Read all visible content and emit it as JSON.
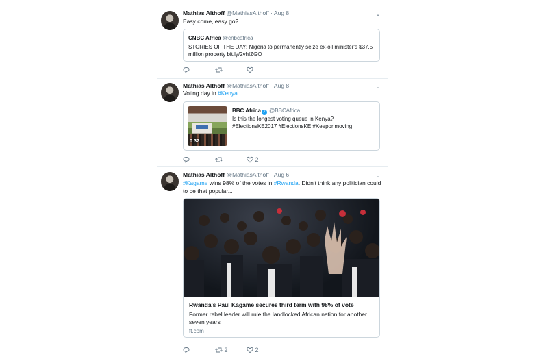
{
  "tweets": [
    {
      "name": "Mathias Althoff",
      "handle": "@MathiasAlthoff",
      "dot": "·",
      "date": "Aug 8",
      "text": "Easy come, easy go?",
      "quote": {
        "name": "CNBC Africa",
        "handle": "@cnbcafrica",
        "text_line1": "STORIES OF THE DAY: Nigeria to permanently seize ex-oil minister's $37.5",
        "text_line2": "million property bit.ly/2vhIZGO"
      },
      "retweets": "",
      "likes": ""
    },
    {
      "name": "Mathias Althoff",
      "handle": "@MathiasAlthoff",
      "dot": "·",
      "date": "Aug 8",
      "text_prefix": "Voting day in ",
      "text_link": "#Kenya",
      "text_suffix": ".",
      "quote": {
        "name": "BBC Africa",
        "handle": "@BBCAfrica",
        "text_line1": "Is this the longest voting queue in Kenya?",
        "text_line2": "#ElectionsKE2017 #ElectionsKE #Keeponmoving",
        "duration": "0:32"
      },
      "retweets": "",
      "likes": "2"
    },
    {
      "name": "Mathias Althoff",
      "handle": "@MathiasAlthoff",
      "dot": "·",
      "date": "Aug 6",
      "text_link1": "#Kagame",
      "text_mid": " wins 98% of the votes in ",
      "text_link2": "#Rwanda",
      "text_end": ". Didn't think any politician could",
      "text_line2": "to be that popular...",
      "card": {
        "title": "Rwanda's Paul Kagame secures third term with 98% of vote",
        "desc": "Former rebel leader will rule the landlocked African nation for another seven years",
        "domain": "ft.com"
      },
      "retweets": "2",
      "likes": "2"
    }
  ],
  "colors": {
    "link": "#1da1f2",
    "muted": "#657786",
    "border": "#ccd6dd"
  },
  "icons": [
    "avatar",
    "chevron-down-icon",
    "reply-icon",
    "retweet-icon",
    "like-icon",
    "verified-icon"
  ]
}
